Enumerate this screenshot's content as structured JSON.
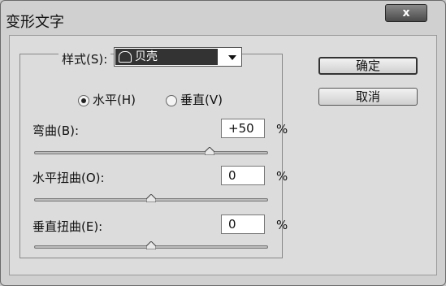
{
  "window": {
    "title": "变形文字",
    "close_label": "x"
  },
  "style": {
    "label": "样式(S):",
    "selected": "贝壳",
    "selected_icon": "shell-icon"
  },
  "orientation": {
    "horizontal_label": "水平(H)",
    "vertical_label": "垂直(V)",
    "selected": "horizontal"
  },
  "bend": {
    "label": "弯曲(B):",
    "value": "+50",
    "unit": "%",
    "slider_fraction": 0.75
  },
  "horizontal_distortion": {
    "label": "水平扭曲(O):",
    "value": "0",
    "unit": "%",
    "slider_fraction": 0.5
  },
  "vertical_distortion": {
    "label": "垂直扭曲(E):",
    "value": "0",
    "unit": "%",
    "slider_fraction": 0.5
  },
  "buttons": {
    "ok": "确定",
    "cancel": "取消"
  }
}
